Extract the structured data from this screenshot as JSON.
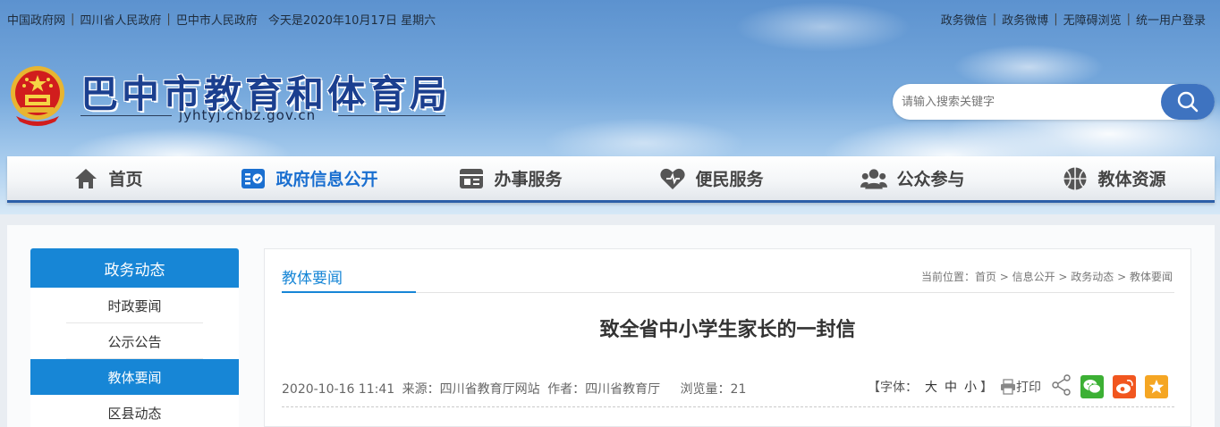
{
  "topbar": {
    "links_left": [
      "中国政府网",
      "四川省人民政府",
      "巴中市人民政府"
    ],
    "date": "今天是2020年10月17日 星期六",
    "links_right": [
      "政务微信",
      "政务微博",
      "无障碍浏览",
      "统一用户登录"
    ]
  },
  "header": {
    "title": "巴中市教育和体育局",
    "domain": "jyhtyj.cnbz.gov.cn"
  },
  "search": {
    "placeholder": "请输入搜索关键字",
    "icon": "search-icon"
  },
  "nav": [
    {
      "label": "首页",
      "icon": "home-icon",
      "active": false
    },
    {
      "label": "政府信息公开",
      "icon": "info-disclosure-icon",
      "active": true
    },
    {
      "label": "办事服务",
      "icon": "service-icon",
      "active": false
    },
    {
      "label": "便民服务",
      "icon": "heart-icon",
      "active": false
    },
    {
      "label": "公众参与",
      "icon": "people-icon",
      "active": false
    },
    {
      "label": "教体资源",
      "icon": "basketball-icon",
      "active": false
    }
  ],
  "sidebar": {
    "title": "政务动态",
    "items": [
      {
        "label": "时政要闻",
        "active": false
      },
      {
        "label": "公示公告",
        "active": false
      },
      {
        "label": "教体要闻",
        "active": true
      },
      {
        "label": "区县动态",
        "active": false
      }
    ]
  },
  "content": {
    "tab": "教体要闻",
    "breadcrumb": "当前位置：首页 > 信息公开 > 政务动态 > 教体要闻",
    "title": "致全省中小学生家长的一封信",
    "meta": {
      "datetime": "2020-10-16 11:41",
      "source": "来源：四川省教育厅网站",
      "author": "作者：四川省教育厅",
      "views": "浏览量：21"
    },
    "tools": {
      "font_label": "【字体：",
      "font_sizes": [
        "大",
        "中",
        "小"
      ],
      "font_end": "】",
      "print_label": "打印"
    }
  },
  "colors": {
    "primary": "#1786d6",
    "nav_active": "#1a6fd0",
    "title_blue": "#1b3f8f",
    "wechat": "#3cb034",
    "weibo": "#f1561f",
    "favorite": "#f5a623"
  }
}
